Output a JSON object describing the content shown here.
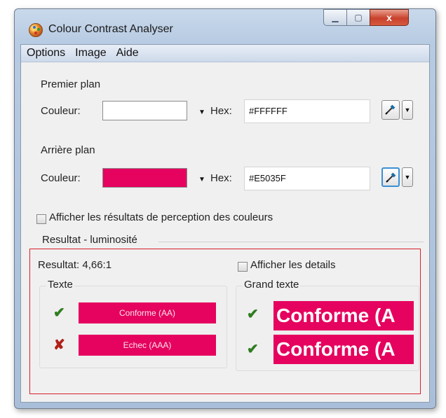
{
  "window": {
    "title": "Colour Contrast Analyser",
    "close_glyph": "x"
  },
  "menu": [
    "Options",
    "Image",
    "Aide"
  ],
  "foreground": {
    "section": "Premier plan",
    "colour_label": "Couleur:",
    "hex_label": "Hex:",
    "hex_value": "#FFFFFF",
    "swatch_color": "#FFFFFF"
  },
  "background": {
    "section": "Arrière plan",
    "colour_label": "Couleur:",
    "hex_label": "Hex:",
    "hex_value": "#E5035F",
    "swatch_color": "#E5035F"
  },
  "perception_checkbox": "Afficher les résultats de perception des couleurs",
  "results": {
    "section": "Resultat - luminosité",
    "ratio_label": "Resultat: 4,66:1",
    "details_checkbox": "Afficher les details",
    "text": {
      "title": "Texte",
      "aa": {
        "status": "pass",
        "label": "Conforme (AA)"
      },
      "aaa": {
        "status": "fail",
        "label": "Echec (AAA)"
      }
    },
    "large_text": {
      "title": "Grand texte",
      "aa": {
        "status": "pass",
        "label": "Conforme (A"
      },
      "aaa": {
        "status": "pass",
        "label": "Conforme (A"
      }
    }
  },
  "icons": {
    "app": "colour-palette-icon",
    "picker": "eyedropper-icon",
    "pass": "check-icon",
    "fail": "cross-icon"
  },
  "glyphs": {
    "pass": "✔",
    "fail": "✘",
    "dropdown": "▼"
  }
}
